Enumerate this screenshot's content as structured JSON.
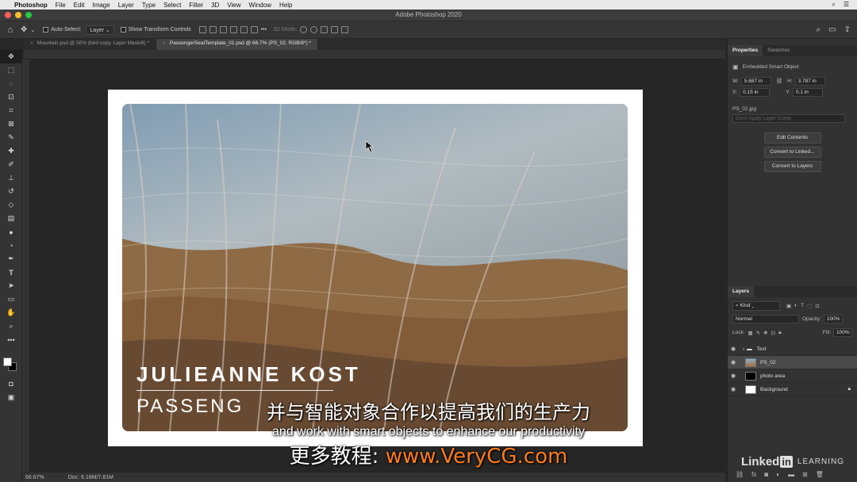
{
  "menubar": {
    "app": "Photoshop",
    "items": [
      "File",
      "Edit",
      "Image",
      "Layer",
      "Type",
      "Select",
      "Filter",
      "3D",
      "View",
      "Window",
      "Help"
    ]
  },
  "window": {
    "title": "Adobe Photoshop 2020"
  },
  "options": {
    "auto_select_label": "Auto-Select:",
    "auto_select_value": "Layer",
    "transform_label": "Show Transform Controls",
    "mode_3d": "3D Mode:"
  },
  "tabs": [
    {
      "label": "Mountain.psd @ 50% (bird copy, Layer Mask/8) *"
    },
    {
      "label": "PassengerSeatTemplate_01.psd @ 66.7% (PS_02, RGB/8*) *"
    }
  ],
  "document": {
    "title_text": "JULIEANNE KOST",
    "subtitle_text": "PASSENG"
  },
  "status": {
    "zoom": "66.67%",
    "doc_size": "Doc: 6.18M/7.81M"
  },
  "properties": {
    "tab_properties": "Properties",
    "tab_swatches": "Swatches",
    "type_label": "Embedded Smart Object",
    "w_label": "W:",
    "w_value": "5.687 in",
    "h_label": "H:",
    "h_value": "3.787 in",
    "x_label": "X:",
    "x_value": "0.15 in",
    "y_label": "Y:",
    "y_value": "0.1 in",
    "filename": "PS_02.jpg",
    "layer_comp": "Don't Apply Layer Comp",
    "btn_edit": "Edit Contents",
    "btn_linked": "Convert to Linked...",
    "btn_layers": "Convert to Layers"
  },
  "layers_panel": {
    "tab": "Layers",
    "filter": "Kind",
    "blend_mode": "Normal",
    "opacity_label": "Opacity:",
    "opacity_value": "100%",
    "lock_label": "Lock:",
    "fill_label": "Fill:",
    "fill_value": "100%",
    "layers": [
      {
        "name": "Text"
      },
      {
        "name": "PS_02"
      },
      {
        "name": "photo area"
      },
      {
        "name": "Background"
      }
    ]
  },
  "overlay": {
    "subtitle_cn": "并与智能对象合作以提高我们的生产力",
    "subtitle_en": "and work with smart objects to enhance our productivity",
    "promo_cn": "更多教程:",
    "promo_url": "www.VeryCG.com",
    "brand_linked": "Linked",
    "brand_in": "in",
    "brand_learning": "LEARNING"
  },
  "colors": {
    "accent_promo": "#ff7a1a",
    "panel_bg": "#323232",
    "canvas_bg": "#262626"
  }
}
